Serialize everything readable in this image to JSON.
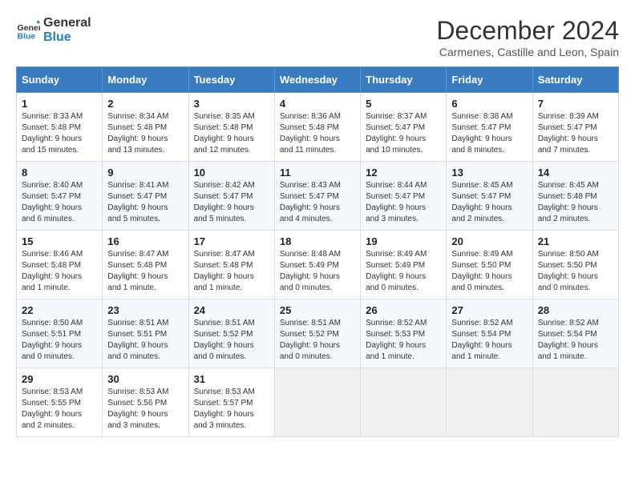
{
  "header": {
    "logo_line1": "General",
    "logo_line2": "Blue",
    "month": "December 2024",
    "location": "Carmenes, Castille and Leon, Spain"
  },
  "days_of_week": [
    "Sunday",
    "Monday",
    "Tuesday",
    "Wednesday",
    "Thursday",
    "Friday",
    "Saturday"
  ],
  "weeks": [
    [
      {
        "day": "1",
        "sunrise": "8:33 AM",
        "sunset": "5:48 PM",
        "daylight": "9 hours and 15 minutes."
      },
      {
        "day": "2",
        "sunrise": "8:34 AM",
        "sunset": "5:48 PM",
        "daylight": "9 hours and 13 minutes."
      },
      {
        "day": "3",
        "sunrise": "8:35 AM",
        "sunset": "5:48 PM",
        "daylight": "9 hours and 12 minutes."
      },
      {
        "day": "4",
        "sunrise": "8:36 AM",
        "sunset": "5:48 PM",
        "daylight": "9 hours and 11 minutes."
      },
      {
        "day": "5",
        "sunrise": "8:37 AM",
        "sunset": "5:47 PM",
        "daylight": "9 hours and 10 minutes."
      },
      {
        "day": "6",
        "sunrise": "8:38 AM",
        "sunset": "5:47 PM",
        "daylight": "9 hours and 8 minutes."
      },
      {
        "day": "7",
        "sunrise": "8:39 AM",
        "sunset": "5:47 PM",
        "daylight": "9 hours and 7 minutes."
      }
    ],
    [
      {
        "day": "8",
        "sunrise": "8:40 AM",
        "sunset": "5:47 PM",
        "daylight": "9 hours and 6 minutes."
      },
      {
        "day": "9",
        "sunrise": "8:41 AM",
        "sunset": "5:47 PM",
        "daylight": "9 hours and 5 minutes."
      },
      {
        "day": "10",
        "sunrise": "8:42 AM",
        "sunset": "5:47 PM",
        "daylight": "9 hours and 5 minutes."
      },
      {
        "day": "11",
        "sunrise": "8:43 AM",
        "sunset": "5:47 PM",
        "daylight": "9 hours and 4 minutes."
      },
      {
        "day": "12",
        "sunrise": "8:44 AM",
        "sunset": "5:47 PM",
        "daylight": "9 hours and 3 minutes."
      },
      {
        "day": "13",
        "sunrise": "8:45 AM",
        "sunset": "5:47 PM",
        "daylight": "9 hours and 2 minutes."
      },
      {
        "day": "14",
        "sunrise": "8:45 AM",
        "sunset": "5:48 PM",
        "daylight": "9 hours and 2 minutes."
      }
    ],
    [
      {
        "day": "15",
        "sunrise": "8:46 AM",
        "sunset": "5:48 PM",
        "daylight": "9 hours and 1 minute."
      },
      {
        "day": "16",
        "sunrise": "8:47 AM",
        "sunset": "5:48 PM",
        "daylight": "9 hours and 1 minute."
      },
      {
        "day": "17",
        "sunrise": "8:47 AM",
        "sunset": "5:48 PM",
        "daylight": "9 hours and 1 minute."
      },
      {
        "day": "18",
        "sunrise": "8:48 AM",
        "sunset": "5:49 PM",
        "daylight": "9 hours and 0 minutes."
      },
      {
        "day": "19",
        "sunrise": "8:49 AM",
        "sunset": "5:49 PM",
        "daylight": "9 hours and 0 minutes."
      },
      {
        "day": "20",
        "sunrise": "8:49 AM",
        "sunset": "5:50 PM",
        "daylight": "9 hours and 0 minutes."
      },
      {
        "day": "21",
        "sunrise": "8:50 AM",
        "sunset": "5:50 PM",
        "daylight": "9 hours and 0 minutes."
      }
    ],
    [
      {
        "day": "22",
        "sunrise": "8:50 AM",
        "sunset": "5:51 PM",
        "daylight": "9 hours and 0 minutes."
      },
      {
        "day": "23",
        "sunrise": "8:51 AM",
        "sunset": "5:51 PM",
        "daylight": "9 hours and 0 minutes."
      },
      {
        "day": "24",
        "sunrise": "8:51 AM",
        "sunset": "5:52 PM",
        "daylight": "9 hours and 0 minutes."
      },
      {
        "day": "25",
        "sunrise": "8:51 AM",
        "sunset": "5:52 PM",
        "daylight": "9 hours and 0 minutes."
      },
      {
        "day": "26",
        "sunrise": "8:52 AM",
        "sunset": "5:53 PM",
        "daylight": "9 hours and 1 minute."
      },
      {
        "day": "27",
        "sunrise": "8:52 AM",
        "sunset": "5:54 PM",
        "daylight": "9 hours and 1 minute."
      },
      {
        "day": "28",
        "sunrise": "8:52 AM",
        "sunset": "5:54 PM",
        "daylight": "9 hours and 1 minute."
      }
    ],
    [
      {
        "day": "29",
        "sunrise": "8:53 AM",
        "sunset": "5:55 PM",
        "daylight": "9 hours and 2 minutes."
      },
      {
        "day": "30",
        "sunrise": "8:53 AM",
        "sunset": "5:56 PM",
        "daylight": "9 hours and 3 minutes."
      },
      {
        "day": "31",
        "sunrise": "8:53 AM",
        "sunset": "5:57 PM",
        "daylight": "9 hours and 3 minutes."
      },
      null,
      null,
      null,
      null
    ]
  ]
}
